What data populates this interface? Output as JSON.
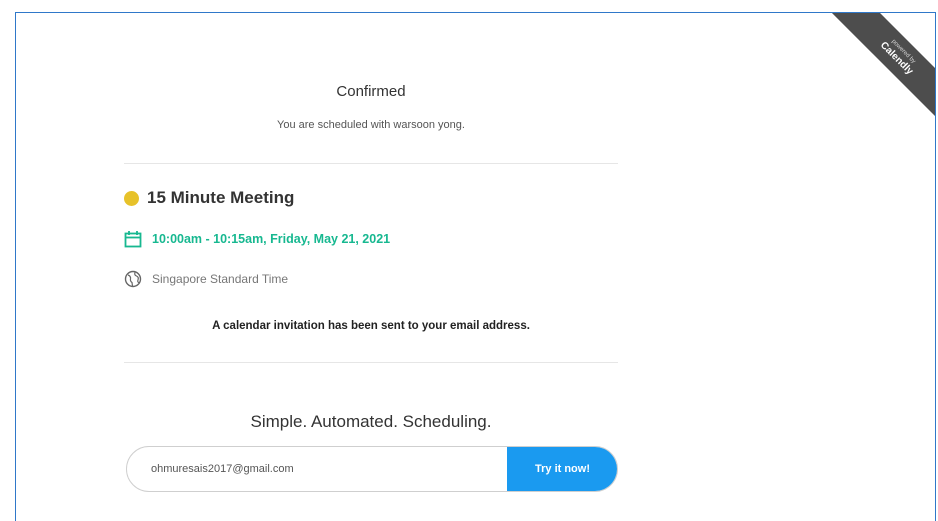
{
  "ribbon": {
    "powered_by": "powered by",
    "brand": "Calendly"
  },
  "confirmation": {
    "title": "Confirmed",
    "subtitle": "You are scheduled with warsoon yong."
  },
  "event": {
    "name": "15 Minute Meeting",
    "dot_color": "#e7c22a",
    "time": "10:00am - 10:15am, Friday, May 21, 2021",
    "time_color": "#17b890",
    "timezone": "Singapore Standard Time"
  },
  "invite_notice": "A calendar invitation has been sent to your email address.",
  "promo": {
    "tagline": "Simple. Automated. Scheduling.",
    "email_value": "ohmuresais2017@gmail.com",
    "button_label": "Try it now!",
    "button_color": "#1a9af0"
  }
}
